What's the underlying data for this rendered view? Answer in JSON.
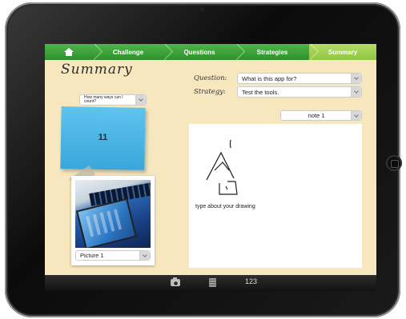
{
  "nav": {
    "home_icon": "home-icon",
    "tabs": [
      {
        "label": "Challenge"
      },
      {
        "label": "Questions"
      },
      {
        "label": "Strategies"
      },
      {
        "label": "Summary"
      }
    ],
    "active_tab": "Summary",
    "colors": {
      "nav_green": "#3aa336",
      "active_green": "#9fd152"
    }
  },
  "summary": {
    "title": "Summary",
    "question_label": "Question:",
    "question_value": "What is this app for?",
    "strategy_label": "Strategy:",
    "strategy_value": "Test the tools.",
    "challenge_dropdown": "How many ways can I count?",
    "sticky_note_value": "11",
    "sticky_color": "#4db8e8",
    "note_dropdown": "note 1",
    "drawing_caption": "type about your drawing",
    "picture_dropdown": "Picture 1"
  },
  "bottombar": {
    "camera_icon": "camera-icon",
    "note_icon": "note-icon",
    "counter_text": "123"
  }
}
